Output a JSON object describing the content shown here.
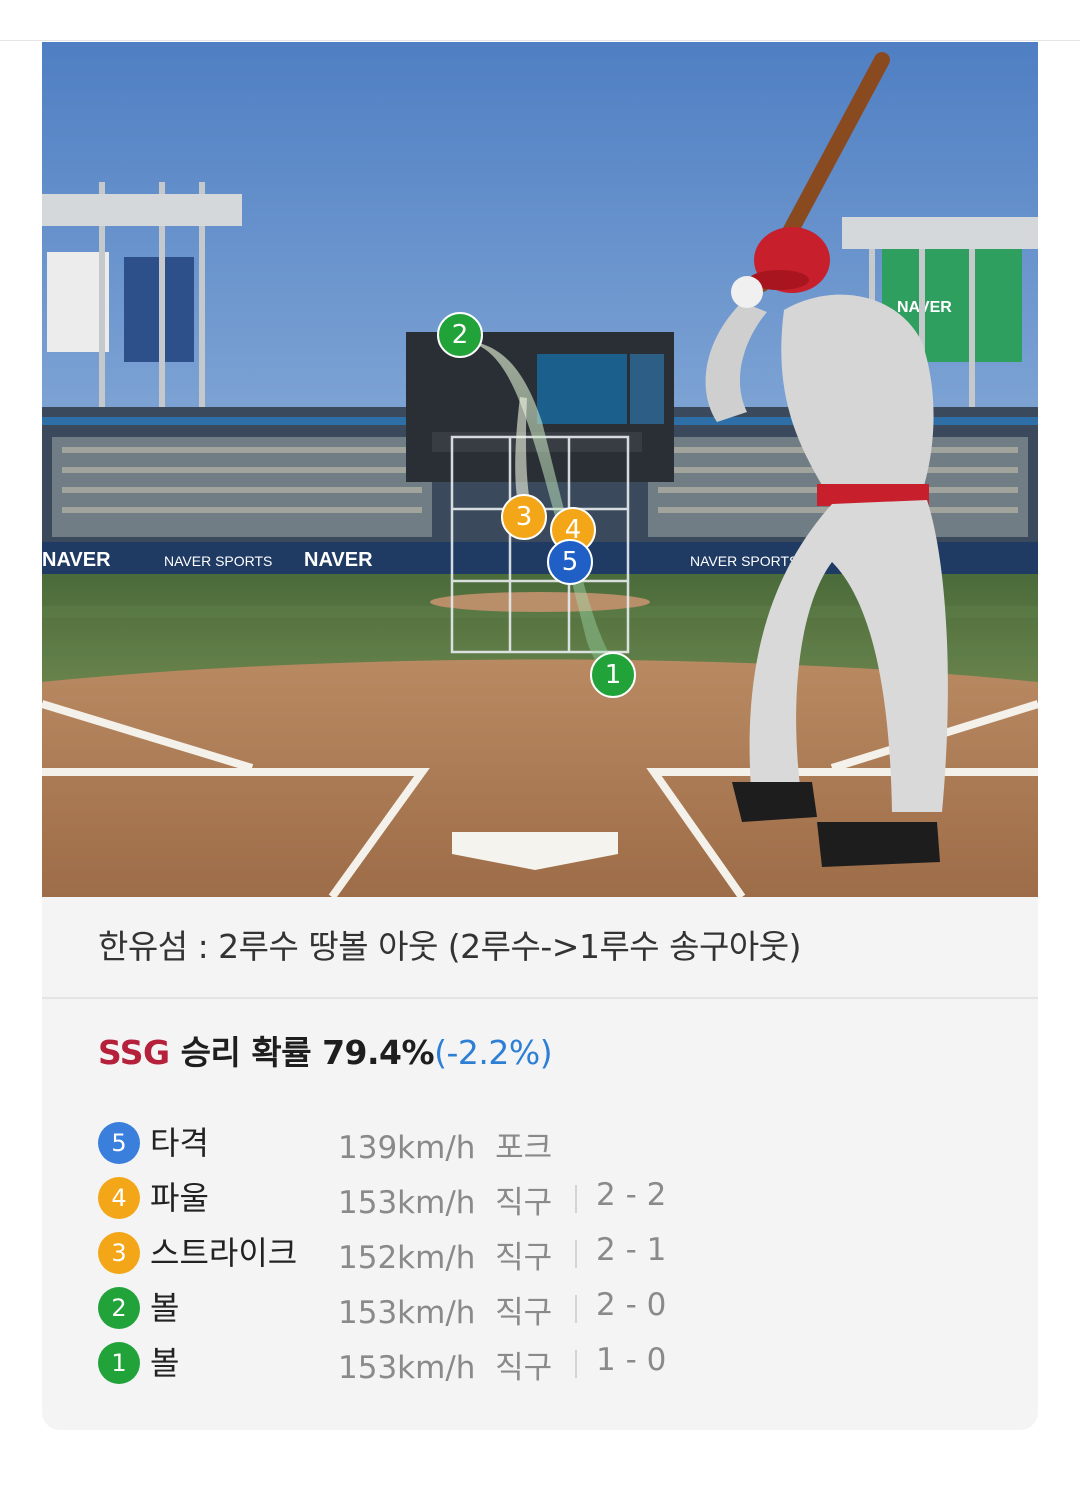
{
  "play": {
    "description": "한유섬 : 2루수 땅볼 아웃 (2루수->1루수 송구아웃)"
  },
  "win_probability": {
    "team": "SSG",
    "label": "승리 확률",
    "value": "79.4%",
    "change": "(-2.2%)",
    "team_color": "#b5203b",
    "change_color": "#2d7fd6"
  },
  "scene": {
    "ads": [
      "NAVER",
      "NAVER SPORTS"
    ],
    "markers": [
      {
        "num": "2",
        "color": "#21a33a"
      },
      {
        "num": "3",
        "color": "#f3a617"
      },
      {
        "num": "4",
        "color": "#f3a617"
      },
      {
        "num": "5",
        "color": "#1f5fc6"
      },
      {
        "num": "1",
        "color": "#21a33a"
      }
    ]
  },
  "pitches": [
    {
      "num": "5",
      "color": "#3a7fdc",
      "result": "타격",
      "speed": "139km/h",
      "type": "포크",
      "count": ""
    },
    {
      "num": "4",
      "color": "#f3a617",
      "result": "파울",
      "speed": "153km/h",
      "type": "직구",
      "count": "2 - 2"
    },
    {
      "num": "3",
      "color": "#f3a617",
      "result": "스트라이크",
      "speed": "152km/h",
      "type": "직구",
      "count": "2 - 1"
    },
    {
      "num": "2",
      "color": "#21a33a",
      "result": "볼",
      "speed": "153km/h",
      "type": "직구",
      "count": "2 - 0"
    },
    {
      "num": "1",
      "color": "#21a33a",
      "result": "볼",
      "speed": "153km/h",
      "type": "직구",
      "count": "1 - 0"
    }
  ]
}
